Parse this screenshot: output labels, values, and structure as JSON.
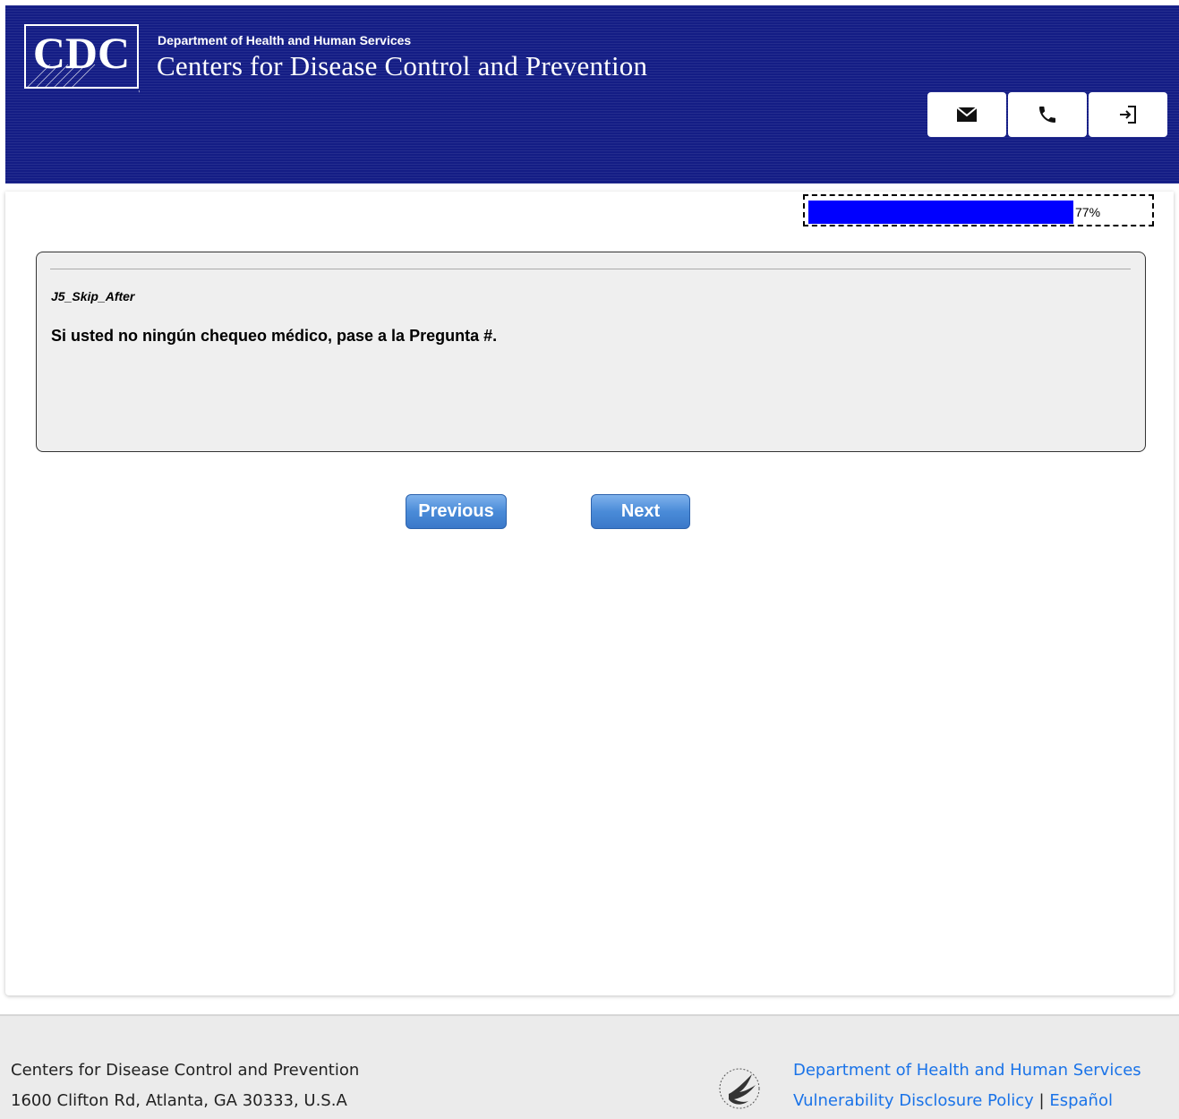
{
  "header": {
    "logo_text": "CDC",
    "department": "Department of Health and Human Services",
    "agency": "Centers for Disease Control and Prevention",
    "background_color": "#141d85",
    "actions": [
      {
        "icon": "mail-icon"
      },
      {
        "icon": "phone-icon"
      },
      {
        "icon": "sign-out-icon"
      }
    ]
  },
  "progress": {
    "percent": 77,
    "label": "77%",
    "color": "#0000ff"
  },
  "question": {
    "id": "J5_Skip_After",
    "text": "Si usted no ningún chequeo médico, pase a la Pregunta #."
  },
  "nav": {
    "previous_label": "Previous",
    "next_label": "Next"
  },
  "footer": {
    "org_name": "Centers for Disease Control and Prevention",
    "address": "1600 Clifton Rd, Atlanta, GA 30333, U.S.A",
    "hhs_link": "Department of Health and Human Services",
    "vdp_link": "Vulnerability Disclosure Policy",
    "separator": "|",
    "espanol_link": "Español",
    "link_color": "#1a73e8"
  }
}
